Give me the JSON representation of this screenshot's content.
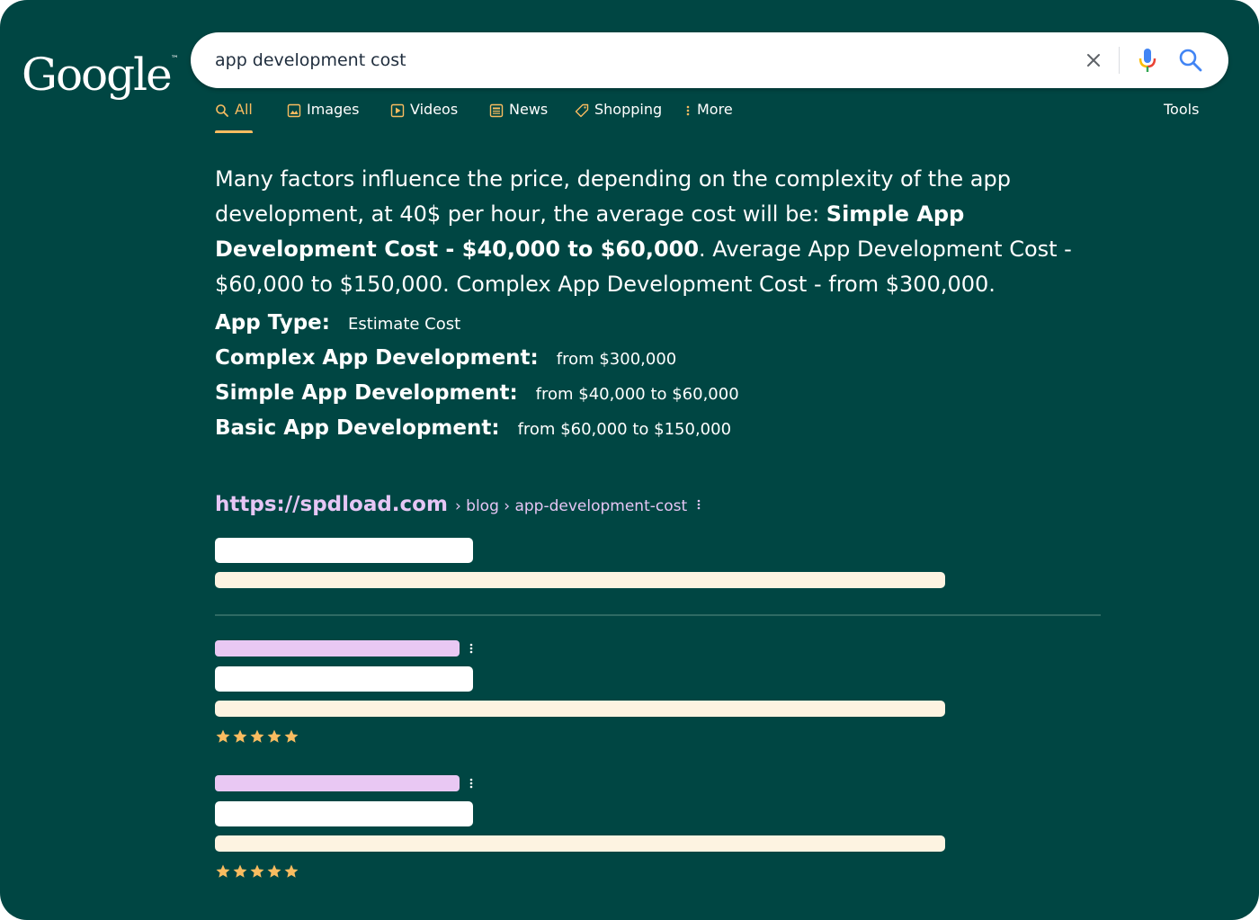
{
  "logo": {
    "text": "Google",
    "tm": "™"
  },
  "search": {
    "query": "app development cost"
  },
  "tabs": [
    {
      "label": "All",
      "icon": "search-icon"
    },
    {
      "label": "Images",
      "icon": "image-icon"
    },
    {
      "label": "Videos",
      "icon": "play-icon"
    },
    {
      "label": "News",
      "icon": "newspaper-icon"
    },
    {
      "label": "Shopping",
      "icon": "tag-icon"
    },
    {
      "label": "More",
      "icon": "more-vert-icon"
    }
  ],
  "tools_label": "Tools",
  "snippet": {
    "part1": "Many factors influence the price, depending on the complexity of the app development, at 40$ per hour, the average cost will be: ",
    "bold": "Simple App Development Cost - $40,000 to $60,000",
    "part2": ". Average App Development Cost - $60,000 to $150,000. Complex App Development Cost - from $300,000."
  },
  "cost_table": [
    {
      "label": "App Type:",
      "value": "Estimate Cost"
    },
    {
      "label": "Complex App Development:",
      "value": "from $300,000"
    },
    {
      "label": "Simple App Development:",
      "value": "from $40,000 to $60,000"
    },
    {
      "label": "Basic App Development:",
      "value": "from $60,000 to $150,000"
    }
  ],
  "result": {
    "domain": "https://spdload.com",
    "path": "› blog › app-development-cost"
  },
  "ratings": [
    5,
    5
  ],
  "colors": {
    "background": "#004643",
    "accent": "#f9bc60",
    "link": "#e6c6f5",
    "placeholder_cream": "#fdf3e1",
    "placeholder_lilac": "#e9c8f3"
  }
}
